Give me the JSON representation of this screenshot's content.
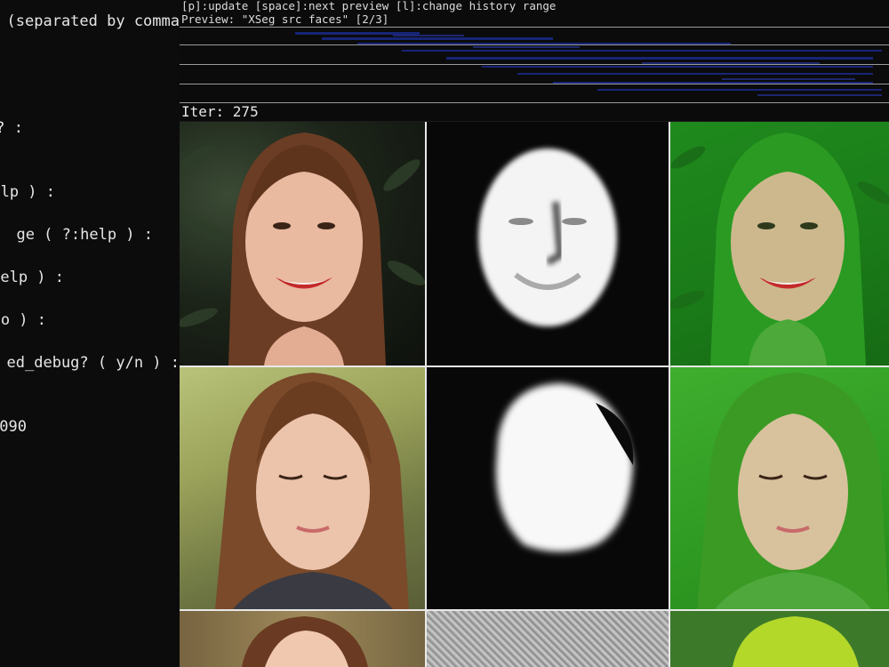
{
  "console": {
    "lines": [
      "(separated by comma",
      "? :",
      "lp ) :",
      "ge ( ?:help ) :",
      "elp ) :",
      "o ) :",
      "ed_debug? ( y/n ) :",
      "090"
    ]
  },
  "preview": {
    "help_line": "[p]:update [space]:next preview [l]:change history range",
    "preview_label": "Preview: \"XSeg src faces\" [2/3]",
    "iter_label": "Iter: 275"
  },
  "grid": {
    "rows": [
      {
        "cells": [
          "source-face",
          "predicted-mask",
          "mask-overlay"
        ]
      },
      {
        "cells": [
          "source-face",
          "predicted-mask",
          "mask-overlay"
        ]
      },
      {
        "cells": [
          "source-face",
          "predicted-mask",
          "mask-overlay"
        ]
      }
    ],
    "overlay_color": "#22a81a",
    "mask_color": "#ffffff"
  }
}
